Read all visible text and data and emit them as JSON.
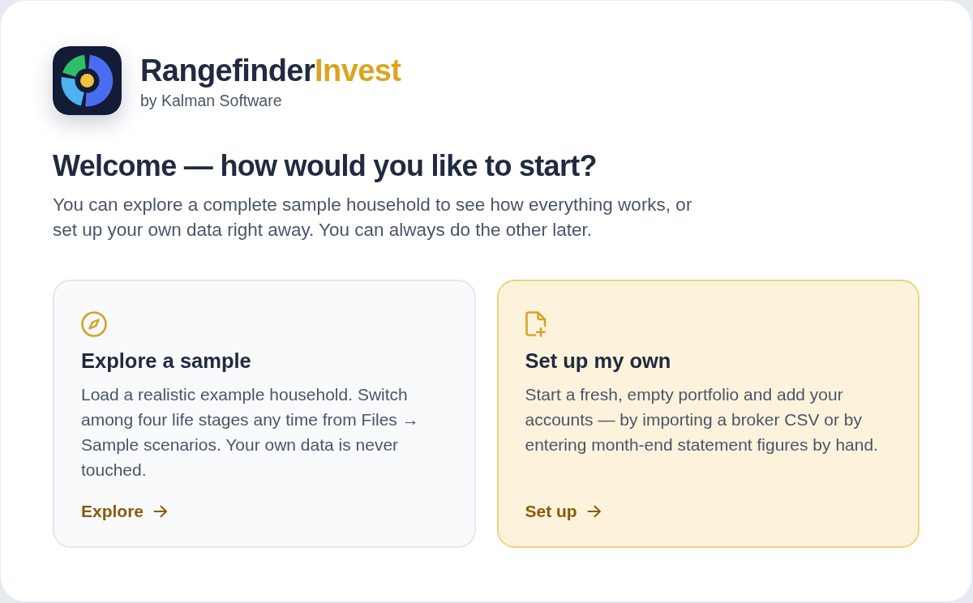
{
  "brand": {
    "name": "Rangefinder",
    "name_accent": "Invest",
    "subtitle": "by Kalman Software"
  },
  "welcome": {
    "heading": "Welcome — how would you like to start?",
    "intro": "You can explore a complete sample household to see how everything works, or set up your own data right away. You can always do the other later."
  },
  "options": [
    {
      "kind": "explore",
      "title": "Explore a sample",
      "description": "Load a realistic example household. Switch among four life stages any time from Files → Sample scenarios. Your own data is never touched.",
      "action": "Explore",
      "selected": false
    },
    {
      "kind": "setup",
      "title": "Set up my own",
      "description": "Start a fresh, empty portfolio and add your accounts — by importing a broker CSV or by entering month-end statement figures by hand.",
      "action": "Set up",
      "selected": true
    }
  ]
}
